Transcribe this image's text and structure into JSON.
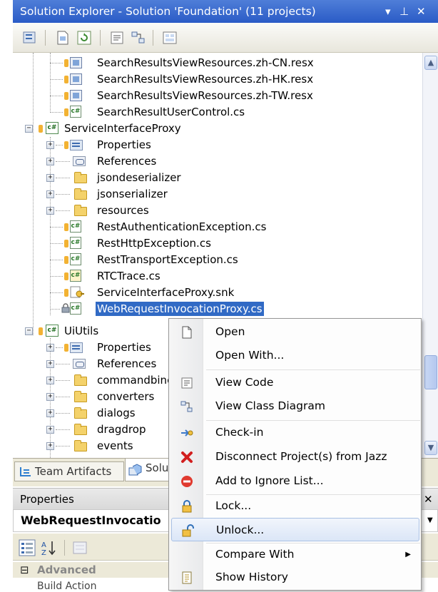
{
  "window": {
    "title": "Solution Explorer - Solution 'Foundation' (11 projects)",
    "pin_icon": "pin-icon",
    "close_label": "✕"
  },
  "tree": {
    "rows": [
      {
        "label": "SearchResultsViewResources.zh-CN.resx",
        "icon": "resx-file-icon"
      },
      {
        "label": "SearchResultsViewResources.zh-HK.resx",
        "icon": "resx-file-icon"
      },
      {
        "label": "SearchResultsViewResources.zh-TW.resx",
        "icon": "resx-file-icon"
      },
      {
        "label": "SearchResultUserControl.cs",
        "icon": "cs-file-icon"
      },
      {
        "label": "ServiceInterfaceProxy",
        "icon": "project-icon"
      },
      {
        "label": "Properties",
        "icon": "properties-icon"
      },
      {
        "label": "References",
        "icon": "references-icon"
      },
      {
        "label": "jsondeserializer",
        "icon": "folder-icon"
      },
      {
        "label": "jsonserializer",
        "icon": "folder-icon"
      },
      {
        "label": "resources",
        "icon": "folder-icon"
      },
      {
        "label": "RestAuthenticationException.cs",
        "icon": "cs-file-icon"
      },
      {
        "label": "RestHttpException.cs",
        "icon": "cs-file-icon"
      },
      {
        "label": "RestTransportException.cs",
        "icon": "cs-file-icon"
      },
      {
        "label": "RTCTrace.cs",
        "icon": "cs-file-icon"
      },
      {
        "label": "ServiceInterfaceProxy.snk",
        "icon": "key-file-icon"
      },
      {
        "label": "WebRequestInvocationProxy.cs",
        "icon": "cs-file-locked-icon",
        "selected": true
      },
      {
        "label": "UiUtils",
        "icon": "project-icon"
      },
      {
        "label": "Properties",
        "icon": "properties-icon"
      },
      {
        "label": "References",
        "icon": "references-icon"
      },
      {
        "label": "commandbinc",
        "icon": "folder-icon"
      },
      {
        "label": "converters",
        "icon": "folder-icon"
      },
      {
        "label": "dialogs",
        "icon": "folder-icon"
      },
      {
        "label": "dragdrop",
        "icon": "folder-icon"
      },
      {
        "label": "events",
        "icon": "folder-icon"
      }
    ]
  },
  "tabs": [
    {
      "label": "Team Artifacts",
      "icon": "team-artifacts-icon"
    },
    {
      "label": "Solu",
      "icon": "solution-explorer-icon",
      "active": true
    }
  ],
  "properties": {
    "header": "Properties",
    "object": "WebRequestInvocatio",
    "category": "Advanced",
    "next_row": "Build Action"
  },
  "context_menu": {
    "items": [
      {
        "label": "Open",
        "icon": "open-icon"
      },
      {
        "label": "Open With...",
        "icon": ""
      },
      {
        "label": "View Code",
        "icon": "view-code-icon"
      },
      {
        "label": "View Class Diagram",
        "icon": "class-diagram-icon"
      },
      {
        "label": "Check-in",
        "icon": "check-in-icon"
      },
      {
        "label": "Disconnect Project(s) from Jazz",
        "icon": "disconnect-icon"
      },
      {
        "label": "Add to Ignore List...",
        "icon": "ignore-icon"
      },
      {
        "label": "Lock...",
        "icon": "lock-icon"
      },
      {
        "label": "Unlock...",
        "icon": "unlock-icon",
        "hover": true
      },
      {
        "label": "Compare With",
        "icon": "",
        "submenu": true
      },
      {
        "label": "Show History",
        "icon": "history-icon"
      }
    ]
  },
  "colors": {
    "title_bar": "#2a5bc6",
    "selection": "#316ac5",
    "folder": "#f4d26b",
    "disconnect_red": "#d21f1f",
    "ignore_red": "#e03a2f"
  }
}
